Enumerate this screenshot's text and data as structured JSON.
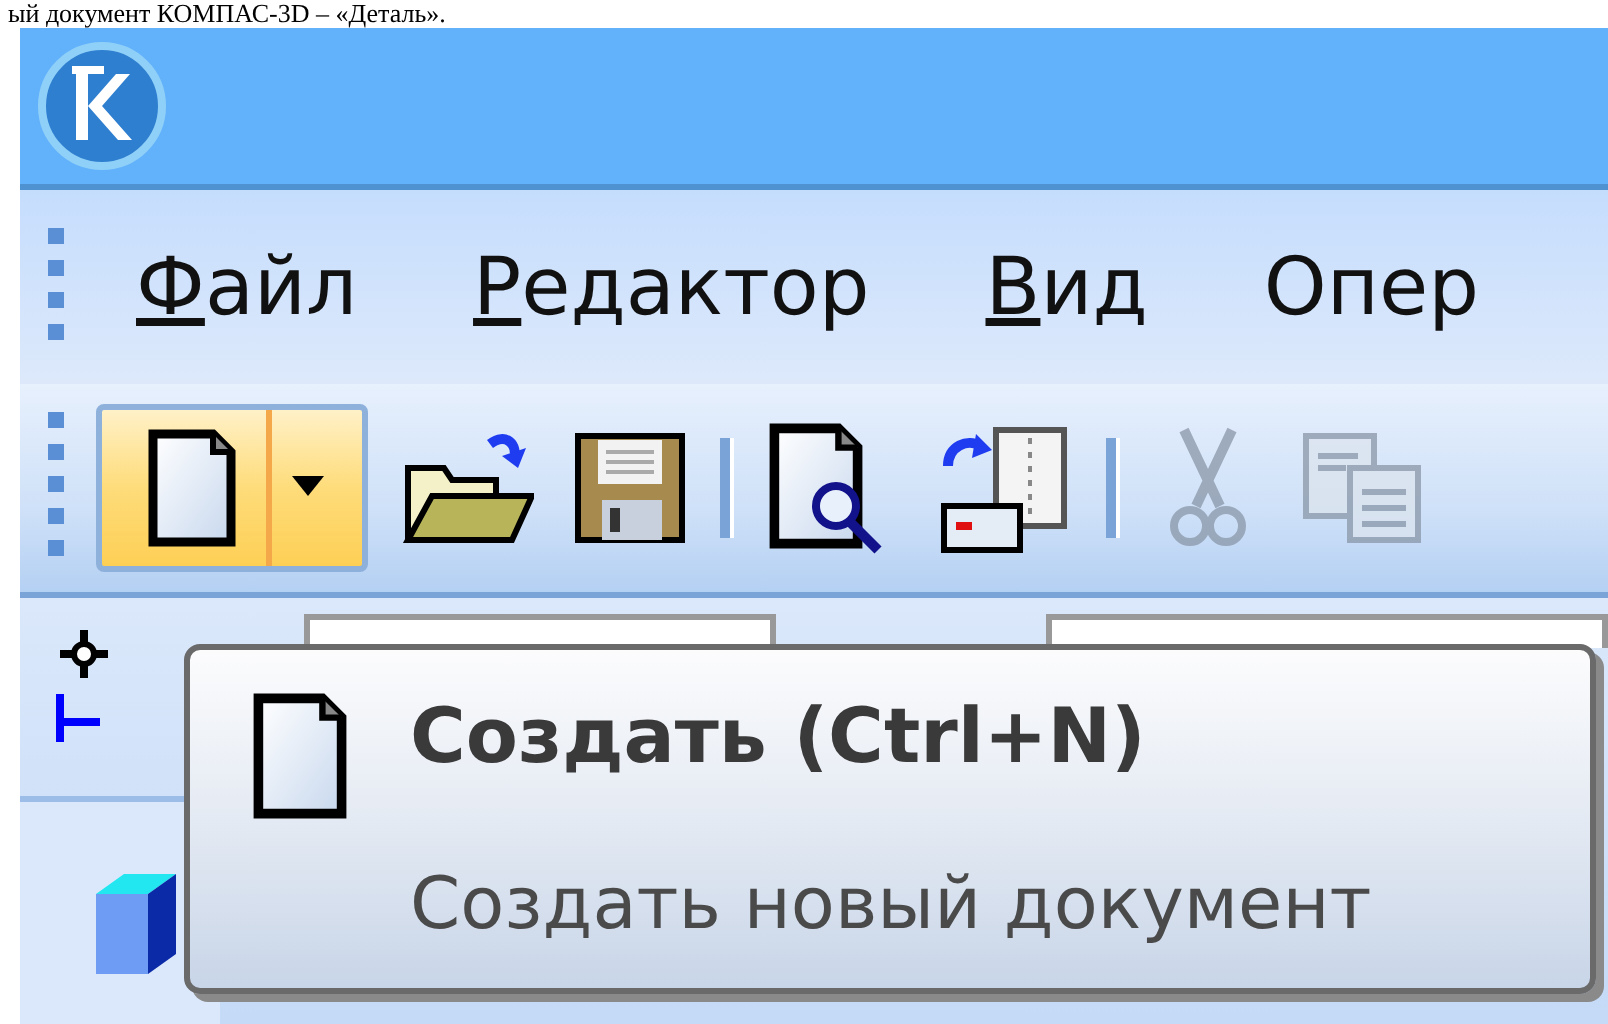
{
  "caption": "ый документ КОМПАС-3D – «Деталь».",
  "menu": [
    {
      "label": "Файл",
      "underlined": true
    },
    {
      "label": "Редактор",
      "underlined": true
    },
    {
      "label": "Вид",
      "underlined": true
    },
    {
      "label": "Опер",
      "underlined": false
    }
  ],
  "toolbar": [
    {
      "kind": "new",
      "selected": true,
      "disabled": false
    },
    {
      "kind": "open",
      "selected": false,
      "disabled": false
    },
    {
      "kind": "save",
      "selected": false,
      "disabled": false
    },
    {
      "kind": "separator"
    },
    {
      "kind": "preview",
      "selected": false,
      "disabled": false
    },
    {
      "kind": "transfer",
      "selected": false,
      "disabled": false
    },
    {
      "kind": "separator"
    },
    {
      "kind": "cut",
      "selected": false,
      "disabled": true
    },
    {
      "kind": "copy",
      "selected": false,
      "disabled": true
    }
  ],
  "tooltip": {
    "title": "Создать (Ctrl+N)",
    "description": "Создать новый документ"
  }
}
